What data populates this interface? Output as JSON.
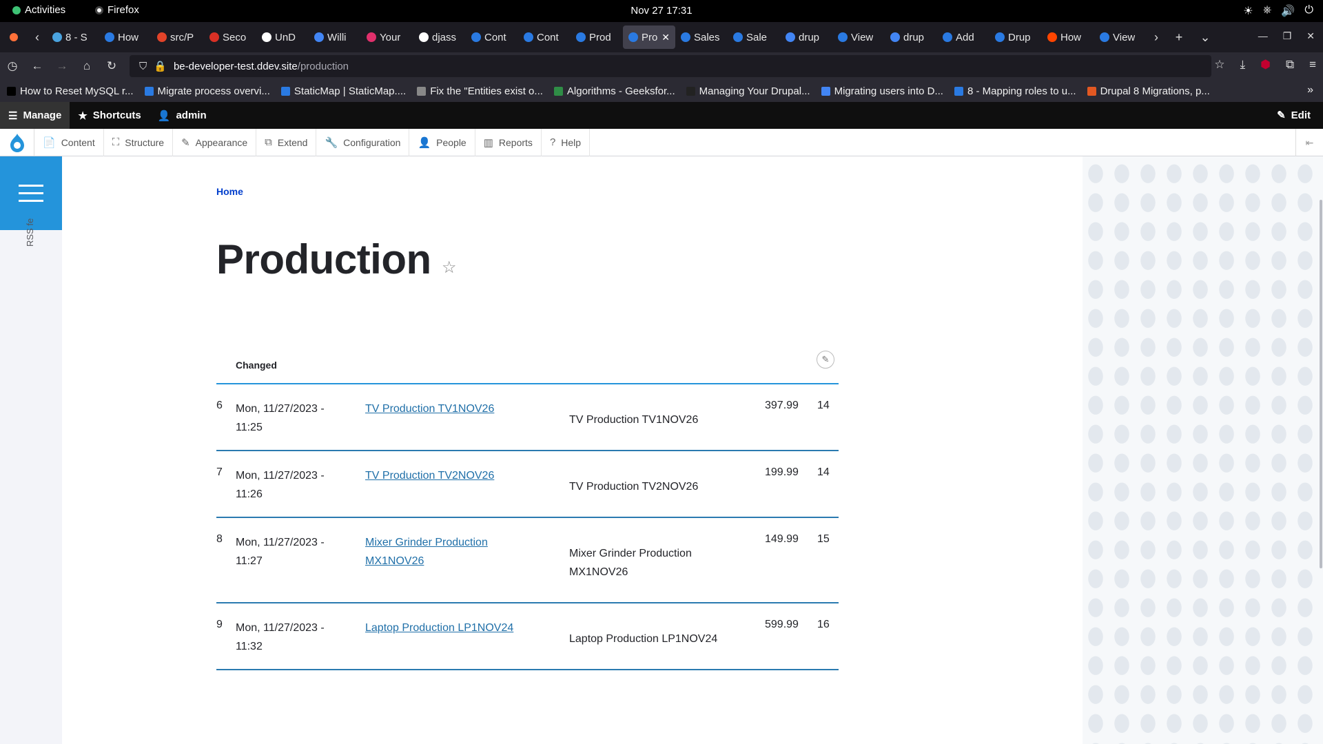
{
  "system": {
    "activities": "Activities",
    "app_name": "Firefox",
    "clock": "Nov 27  17:31"
  },
  "browser": {
    "tabs": [
      {
        "label": "8 - S",
        "color": "#4aa3df"
      },
      {
        "label": "How",
        "color": "#2a7ae2"
      },
      {
        "label": "src/P",
        "color": "#e24329"
      },
      {
        "label": "Seco",
        "color": "#d93025"
      },
      {
        "label": "UnD",
        "color": "#ffffff"
      },
      {
        "label": "Willi",
        "color": "#4285f4"
      },
      {
        "label": "Your",
        "color": "#e1306c"
      },
      {
        "label": "djass",
        "color": "#ffffff"
      },
      {
        "label": "Cont",
        "color": "#2a7ae2"
      },
      {
        "label": "Cont",
        "color": "#2a7ae2"
      },
      {
        "label": "Prod",
        "color": "#2a7ae2"
      },
      {
        "label": "Pro",
        "color": "#2a7ae2",
        "active": true
      },
      {
        "label": "Sales",
        "color": "#2a7ae2"
      },
      {
        "label": "Sale",
        "color": "#2a7ae2"
      },
      {
        "label": "drup",
        "color": "#4285f4"
      },
      {
        "label": "View",
        "color": "#2a7ae2"
      },
      {
        "label": "drup",
        "color": "#4285f4"
      },
      {
        "label": "Add",
        "color": "#2a7ae2"
      },
      {
        "label": "Drup",
        "color": "#2a7ae2"
      },
      {
        "label": "How",
        "color": "#ff4500"
      },
      {
        "label": "View",
        "color": "#2a7ae2"
      }
    ],
    "url_domain": "be-developer-test.ddev.site",
    "url_path": "/production",
    "url_prefix": "",
    "bookmarks": [
      "How to Reset MySQL r...",
      "Migrate process overvi...",
      "StaticMap | StaticMap....",
      "Fix the \"Entities exist o...",
      "Algorithms - Geeksfor...",
      "Managing Your Drupal...",
      "Migrating users into D...",
      "8 - Mapping roles to u...",
      "Drupal 8 Migrations, p..."
    ]
  },
  "admin_toolbar": {
    "manage": "Manage",
    "shortcuts": "Shortcuts",
    "user": "admin",
    "edit": "Edit",
    "menu": [
      "Content",
      "Structure",
      "Appearance",
      "Extend",
      "Configuration",
      "People",
      "Reports",
      "Help"
    ]
  },
  "sidebar": {
    "rss_label": "RSS fe"
  },
  "page": {
    "breadcrumb": "Home",
    "title": "Production",
    "table": {
      "header_changed": "Changed",
      "rows": [
        {
          "id": "6",
          "date_line1": "Mon, 11/27/2023 -",
          "date_line2": "11:25",
          "link": "TV Production TV1NOV26",
          "title": "TV Production TV1NOV26",
          "price": "397.99",
          "qty": "14"
        },
        {
          "id": "7",
          "date_line1": "Mon, 11/27/2023 -",
          "date_line2": "11:26",
          "link": "TV Production TV2NOV26",
          "title": "TV Production TV2NOV26",
          "price": "199.99",
          "qty": "14"
        },
        {
          "id": "8",
          "date_line1": "Mon, 11/27/2023 -",
          "date_line2": "11:27",
          "link": "Mixer Grinder Production MX1NOV26",
          "title": "Mixer Grinder Production MX1NOV26",
          "price": "149.99",
          "qty": "15"
        },
        {
          "id": "9",
          "date_line1": "Mon, 11/27/2023 -",
          "date_line2": "11:32",
          "link": "Laptop Production LP1NOV24",
          "title": "Laptop Production LP1NOV24",
          "price": "599.99",
          "qty": "16"
        }
      ]
    }
  }
}
